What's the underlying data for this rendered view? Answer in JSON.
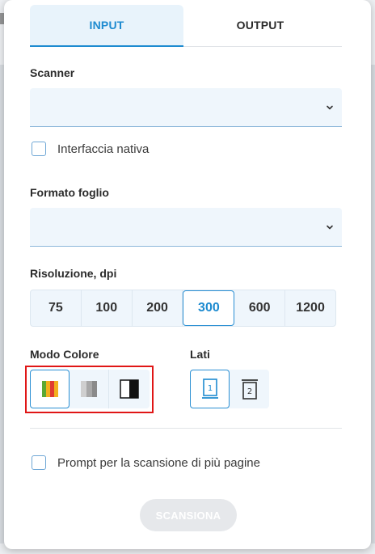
{
  "tabs": [
    {
      "label": "INPUT",
      "active": true
    },
    {
      "label": "OUTPUT",
      "active": false
    }
  ],
  "scanner": {
    "label": "Scanner",
    "value": ""
  },
  "native_ui": {
    "label": "Interfaccia nativa",
    "checked": false
  },
  "paper_size": {
    "label": "Formato foglio",
    "value": ""
  },
  "resolution": {
    "label": "Risoluzione, dpi",
    "options": [
      "75",
      "100",
      "200",
      "300",
      "600",
      "1200"
    ],
    "selected": "300"
  },
  "color_mode": {
    "label": "Modo Colore",
    "options": [
      "color-icon",
      "grayscale-icon",
      "black-white-icon"
    ],
    "selected": "color-icon"
  },
  "sides": {
    "label": "Lati",
    "options": [
      "single-side-icon",
      "double-side-icon"
    ],
    "selected": "single-side-icon",
    "single_number": "1",
    "double_number": "2"
  },
  "multi_page": {
    "label": "Prompt per la scansione di più pagine",
    "checked": false
  },
  "scan_button": {
    "label": "SCANSIONA",
    "enabled": false
  },
  "colors": {
    "accent": "#1e8bd0",
    "highlight": "#e01616",
    "field_bg": "#eff6fc"
  }
}
